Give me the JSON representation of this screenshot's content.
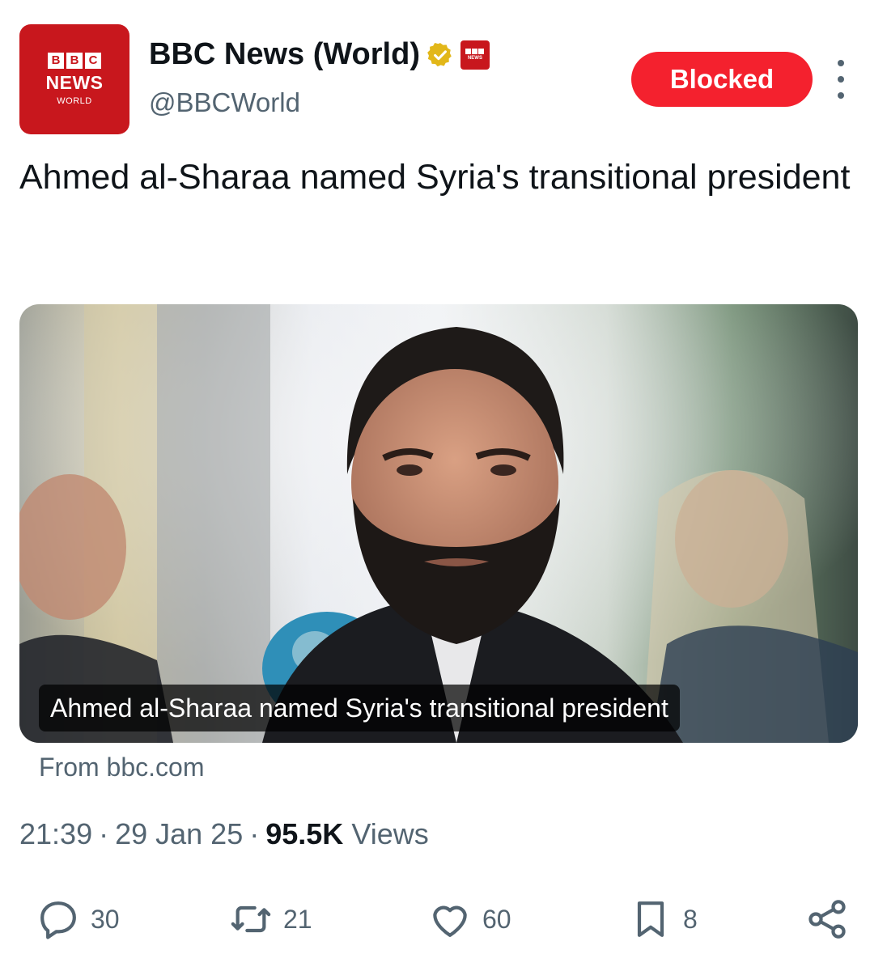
{
  "account": {
    "avatar_blocks": [
      "B",
      "B",
      "C"
    ],
    "avatar_news": "NEWS",
    "avatar_world": "WORLD",
    "display_name": "BBC News (World)",
    "handle": "@BBCWorld",
    "affiliate_badge_label": "NEWS",
    "blocked_label": "Blocked"
  },
  "post": {
    "text": "Ahmed al-Sharaa named Syria's transitional president"
  },
  "card": {
    "caption": "Ahmed al-Sharaa named Syria's transitional president",
    "source": "From bbc.com"
  },
  "meta": {
    "time": "21:39",
    "date": "29 Jan 25",
    "views_count": "95.5K",
    "views_label": "Views"
  },
  "actions": {
    "replies": "30",
    "reposts": "21",
    "likes": "60",
    "bookmarks": "8"
  },
  "colors": {
    "brand_red": "#c8171d",
    "blocked_red": "#f4212e",
    "secondary_text": "#536471",
    "verified_gold": "#e2b719"
  }
}
